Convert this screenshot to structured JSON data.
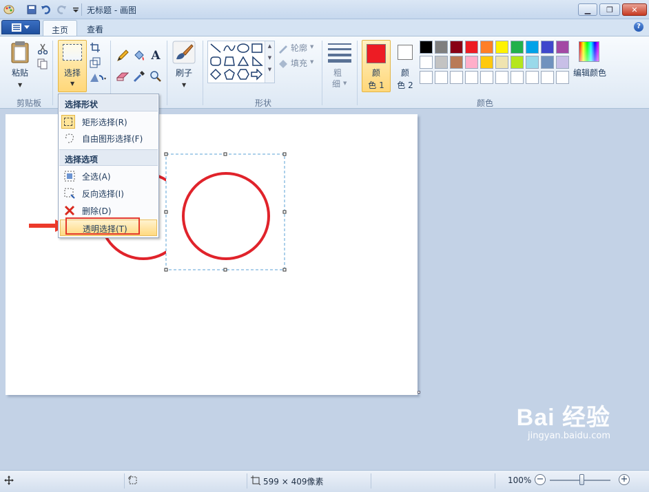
{
  "window": {
    "title": "无标题 - 画图",
    "minimize": "▁",
    "restore": "❐",
    "close": "✕",
    "help": "?"
  },
  "tabs": {
    "home": "主页",
    "view": "查看"
  },
  "ribbon": {
    "clipboard": {
      "paste": "粘贴",
      "group": "剪贴板"
    },
    "image": {
      "select": "选择"
    },
    "brush": {
      "label": "刷子"
    },
    "shapes": {
      "outline": "轮廓",
      "fill": "填充",
      "group": "形状"
    },
    "size": {
      "label1": "粗",
      "label2": "细"
    },
    "colors": {
      "color1_a": "颜",
      "color1_b": "色 1",
      "color2_a": "颜",
      "color2_b": "色 2",
      "edit": "编辑颜色",
      "group": "颜色",
      "color1": "#ed1c24",
      "color2": "#ffffff",
      "palette": [
        "#000000",
        "#7f7f7f",
        "#880015",
        "#ed1c24",
        "#ff7f27",
        "#fff200",
        "#22b14c",
        "#00a2e8",
        "#3f48cc",
        "#a349a4",
        "#ffffff",
        "#c3c3c3",
        "#b97a57",
        "#ffaec9",
        "#ffc90e",
        "#efe4b0",
        "#b5e61d",
        "#99d9ea",
        "#7092be",
        "#c8bfe7"
      ]
    }
  },
  "menu": {
    "header_shape": "选择形状",
    "items_shape": [
      "矩形选择(R)",
      "自由图形选择(F)"
    ],
    "header_options": "选择选项",
    "items_options": [
      "全选(A)",
      "反向选择(I)",
      "删除(D)",
      "透明选择(T)"
    ]
  },
  "status": {
    "size": "599 × 409像素",
    "zoom": "100%"
  },
  "watermark": {
    "brand": "Bai  经验",
    "url": "jingyan.baidu.com"
  }
}
